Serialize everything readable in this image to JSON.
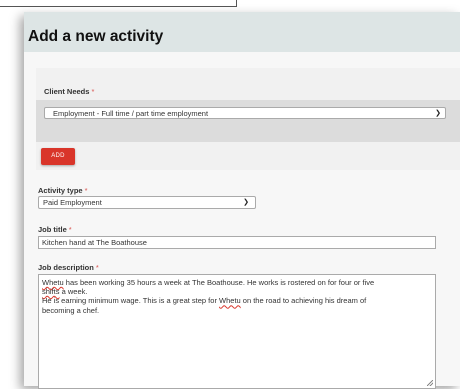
{
  "modal": {
    "title": "Add a new activity"
  },
  "client_needs": {
    "label": "Client Needs",
    "required_mark": "*",
    "selected": "Employment - Full time / part time employment",
    "add_label": "ADD"
  },
  "activity_type": {
    "label": "Activity type",
    "required_mark": "*",
    "selected": "Paid Employment"
  },
  "job_title": {
    "label": "Job title",
    "required_mark": "*",
    "value": "Kitchen hand at The Boathouse"
  },
  "job_description": {
    "label": "Job description",
    "required_mark": "*",
    "line1_pre": "Whetu",
    "line1_rest": " has been working 35 hours a week at The Boathouse. He works is rostered on for four or five",
    "line2_pre": "shifts",
    "line2_rest": " a week.",
    "line3_pre": "He is earning minimum wage. This is a great step for ",
    "line3_word": "Whetu",
    "line3_rest": " on the road to achieving his dream of",
    "line4": "becoming a chef."
  },
  "icons": {
    "dropdown": "chevron-down-icon",
    "resize": "resize-handle-icon"
  },
  "colors": {
    "header_bg": "#dde5e5",
    "add_button": "#d9352a",
    "required": "#d9534f"
  }
}
